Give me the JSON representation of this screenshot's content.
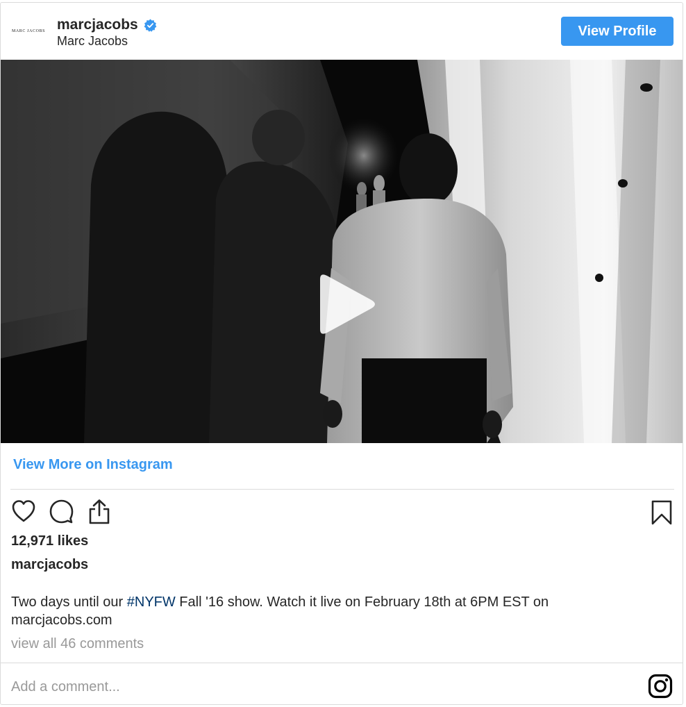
{
  "header": {
    "avatar_text": "MARC JACOBS",
    "username": "marcjacobs",
    "full_name": "Marc Jacobs",
    "verified_icon": "verified-badge-icon",
    "view_profile_label": "View Profile"
  },
  "media": {
    "type": "video",
    "play_icon": "play-icon"
  },
  "view_more_label": "View More on Instagram",
  "actions": {
    "like_icon": "heart-icon",
    "comment_icon": "comment-bubble-icon",
    "share_icon": "share-icon",
    "save_icon": "bookmark-icon"
  },
  "likes_text": "12,971 likes",
  "caption": {
    "username": "marcjacobs",
    "text_before": "Two days until our ",
    "hashtag": "#NYFW",
    "text_after": " Fall '16 show. Watch it live on February 18th at 6PM EST on marcjacobs.com"
  },
  "view_comments_label": "view all 46 comments",
  "comment_placeholder": "Add a comment...",
  "instagram_icon": "instagram-logo-icon",
  "colors": {
    "accent": "#3897f0",
    "hashtag": "#003569",
    "muted": "#999999",
    "text": "#262626",
    "divider": "#dbdbdb"
  }
}
